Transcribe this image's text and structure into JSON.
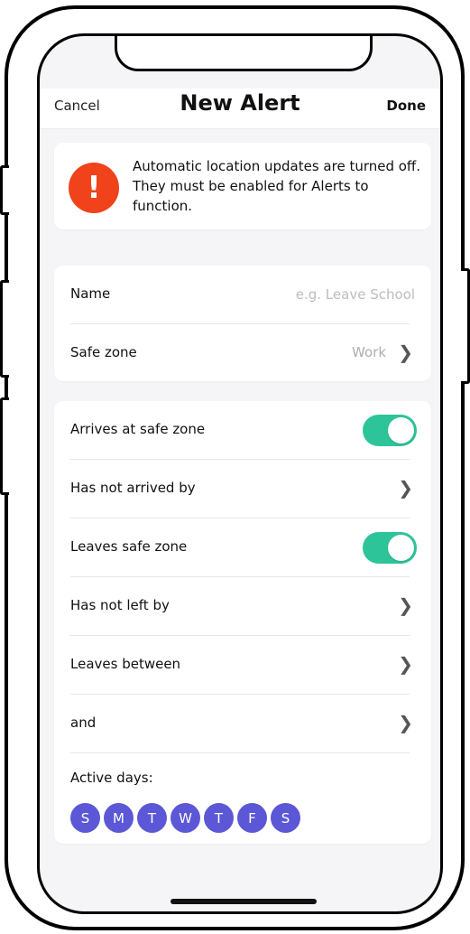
{
  "nav": {
    "cancel": "Cancel",
    "title": "New Alert",
    "done": "Done"
  },
  "alert": {
    "icon": "!",
    "icon_name": "exclamation-icon",
    "message": "Automatic location updates are turned off. They must be enabled for Alerts to function.",
    "color": "#f0421b"
  },
  "form": {
    "name_label": "Name",
    "name_placeholder": "e.g. Leave School",
    "name_value": "",
    "safe_zone_label": "Safe zone",
    "safe_zone_value": "Work"
  },
  "options": {
    "arrives_label": "Arrives at safe zone",
    "arrives_on": true,
    "not_arrived_label": "Has not arrived by",
    "leaves_label": "Leaves safe zone",
    "leaves_on": true,
    "not_left_label": "Has not left by",
    "leaves_between_label": "Leaves between",
    "and_label": "and",
    "toggle_color": "#2ec49a"
  },
  "days": {
    "label": "Active days:",
    "items": [
      "S",
      "M",
      "T",
      "W",
      "T",
      "F",
      "S"
    ],
    "color": "#5b57d6"
  }
}
